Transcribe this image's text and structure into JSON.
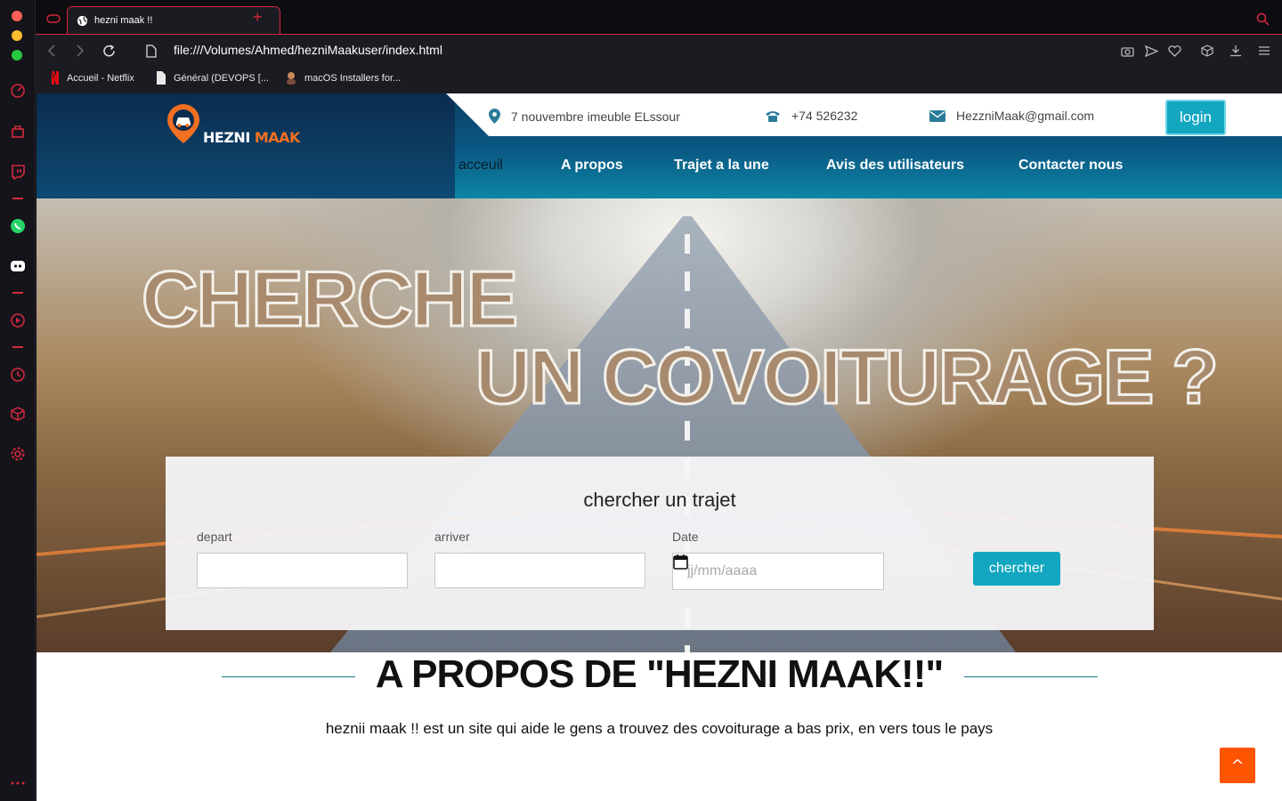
{
  "browser": {
    "tab_title": "hezni maak !!",
    "new_tab_symbol": "+",
    "url": "file:///Volumes/Ahmed/hezniMaakuser/index.html",
    "bookmarks": [
      {
        "label": "Accueil - Netflix",
        "icon": "netflix-icon"
      },
      {
        "label": "Général (DEVOPS [...",
        "icon": "document-icon"
      },
      {
        "label": "macOS Installers for...",
        "icon": "avatar-icon"
      }
    ],
    "accent_color": "#d4283c"
  },
  "header": {
    "logo": {
      "word1": "HEZNI",
      "word2": "MAAK"
    },
    "address": "7 nouvembre imeuble ELssour",
    "phone": "+74 526232",
    "email": "HezzniMaak@gmail.com",
    "login_label": "login",
    "nav": [
      "acceuil",
      "A propos",
      "Trajet a la une",
      "Avis des utilisateurs",
      "Contacter nous"
    ]
  },
  "hero": {
    "title_line1": "CHERCHE",
    "title_line2": "UN COVOITURAGE ?"
  },
  "search": {
    "title": "chercher un trajet",
    "depart_label": "depart",
    "depart_value": "",
    "arriver_label": "arriver",
    "arriver_value": "",
    "date_label": "Date",
    "date_placeholder": "jj/mm/aaaa",
    "button_label": "chercher"
  },
  "about": {
    "title": "A PROPOS DE \"HEZNI MAAK!!\"",
    "text": "heznii maak !! est un site qui aide le gens a trouvez des covoiturage a bas prix, en vers tous le pays"
  },
  "scroll_top_label": "^",
  "colors": {
    "primary": "#12a6c1",
    "orange": "#f37021",
    "scroll_btn": "#ff5500"
  }
}
